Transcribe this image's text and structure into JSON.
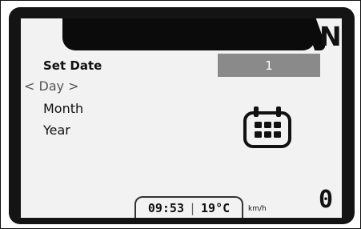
{
  "header": {
    "gear": "N"
  },
  "menu": {
    "title": "Set Date",
    "items": [
      {
        "label": "< Day >",
        "selected": true
      },
      {
        "label": "Month",
        "selected": false
      },
      {
        "label": "Year",
        "selected": false
      }
    ]
  },
  "value": {
    "current": "1"
  },
  "status": {
    "time": "09:53",
    "temperature": "19°C",
    "divider": "|",
    "speed": "0",
    "speed_unit": "km/h"
  },
  "icons": {
    "calendar": "calendar-icon"
  }
}
